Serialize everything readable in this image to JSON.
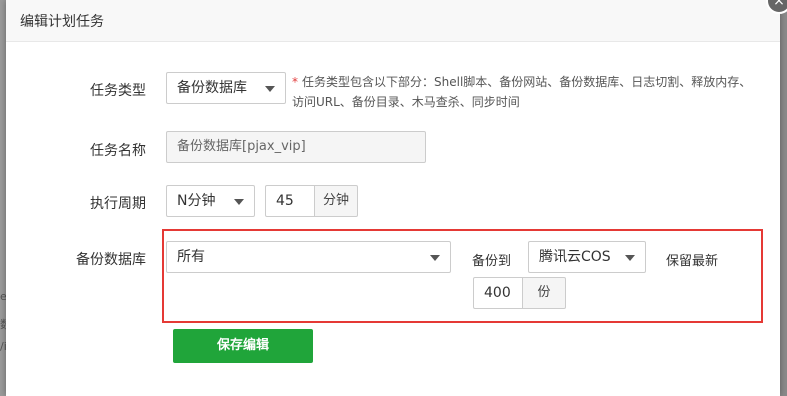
{
  "dialog": {
    "title": "编辑计划任务",
    "close_glyph": "×"
  },
  "backdrop": {
    "ghost_chars": [
      "e",
      "数",
      "/i"
    ]
  },
  "form": {
    "task_type": {
      "label": "任务类型",
      "value": "备份数据库",
      "hint_star": "*",
      "hint_line1": "任务类型包含以下部分：Shell脚本、备份网站、备份数据库、日志切割、释放内存、",
      "hint_line2": "访问URL、备份目录、木马查杀、同步时间"
    },
    "task_name": {
      "label": "任务名称",
      "value": "备份数据库[pjax_vip]"
    },
    "period": {
      "label": "执行周期",
      "unit_select": "N分钟",
      "minutes_value": "45",
      "minutes_unit": "分钟"
    },
    "backup_db": {
      "label": "备份数据库",
      "db_select": "所有",
      "backup_to_label": "备份到",
      "destination": "腾讯云COS",
      "keep_latest_label": "保留最新",
      "keep_count": "400",
      "keep_unit": "份"
    },
    "save_label": "保存编辑"
  },
  "colors": {
    "primary": "#20a53a",
    "highlight_border": "#e53935",
    "hint_star": "#e23c3c"
  }
}
